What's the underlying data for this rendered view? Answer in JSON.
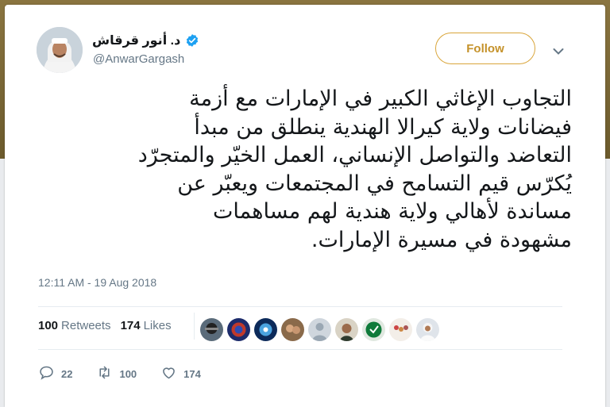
{
  "user": {
    "display_name": "د. أنور قرقاش",
    "handle": "@AnwarGargash",
    "verified_icon": "verified-badge-icon",
    "avatar_icon": "avatar"
  },
  "follow_button": {
    "label": "Follow"
  },
  "menu_icon": "chevron-down-icon",
  "tweet": {
    "text": "التجاوب الإغاثي الكبير في الإمارات مع أزمة\nفيضانات ولاية كيرالا الهندية ينطلق من مبدأ\nالتعاضد والتواصل الإنساني، العمل الخيّر والمتجرّد\nيُكرّس قيم التسامح في المجتمعات ويعبّر عن\nمساندة لأهالي ولاية هندية لهم مساهمات\nمشهودة في مسيرة الإمارات.",
    "timestamp": "12:11 AM - 19 Aug 2018"
  },
  "stats": {
    "retweets_count": "100",
    "retweets_label": "Retweets",
    "likes_count": "174",
    "likes_label": "Likes"
  },
  "actions": {
    "replies": "22",
    "retweets": "100",
    "likes": "174"
  },
  "colors": {
    "accent": "#c5922a",
    "verified": "#1da1f2",
    "muted": "#657786",
    "text": "#14171a"
  }
}
